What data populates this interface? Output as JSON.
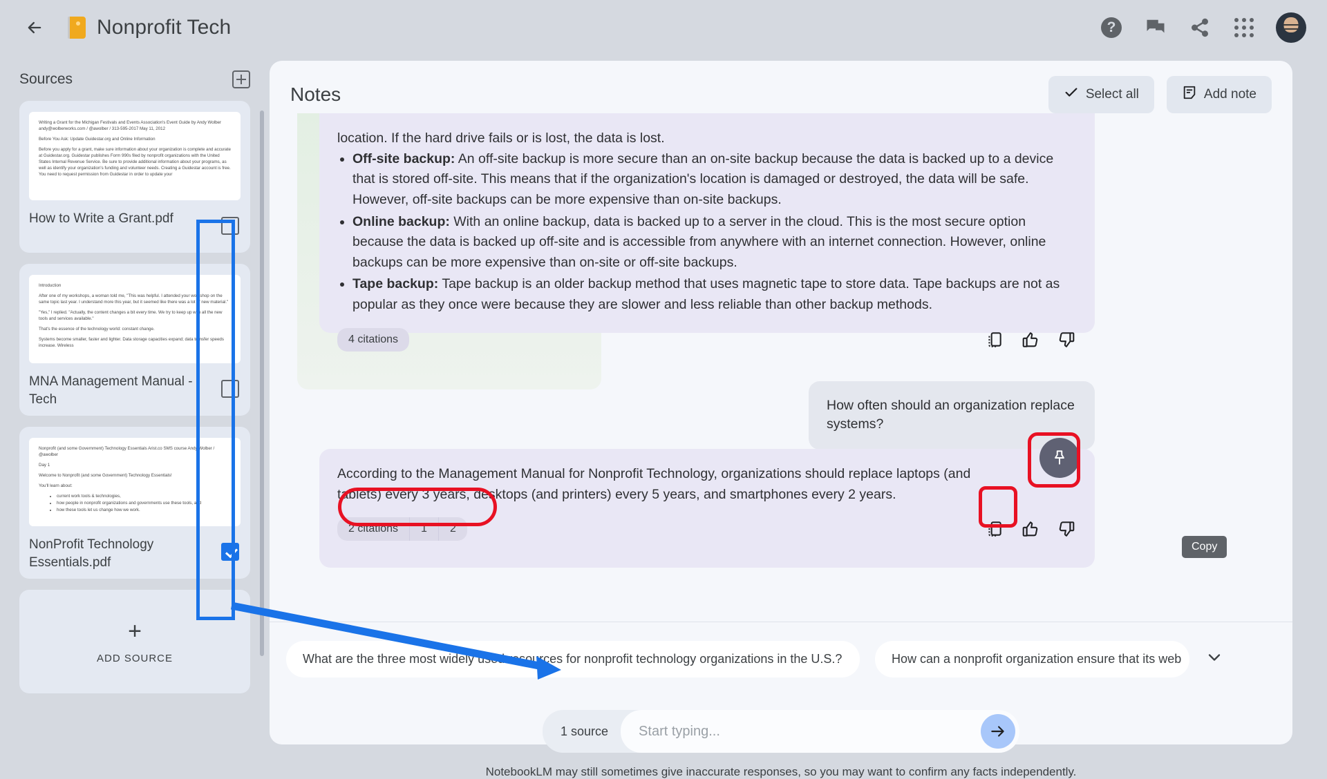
{
  "app": {
    "notebook_title": "Nonprofit Tech",
    "back_icon": "back-arrow-icon",
    "notebook_icon": "notebook-icon",
    "help_label": "?",
    "icons": [
      "help-icon",
      "feedback-icon",
      "share-icon",
      "apps-grid-icon",
      "avatar"
    ]
  },
  "sidebar": {
    "title": "Sources",
    "add_source_icon": "add-box-icon",
    "add_source_label": "ADD SOURCE",
    "sources": [
      {
        "name": "How to Write a Grant.pdf",
        "checked": false,
        "preview": [
          "Writing a Grant for the Michigan Festivals and Events Association's Event Guide by Andy Wolber andy@wolberworks.com / @awolber / 313-595-2017 May 11, 2012",
          "Before You Ask: Update Guidestar.org and Online Information",
          "Before you apply for a grant, make sure information about your organization is complete and accurate at Guidestar.org. Guidestar publishes Form 990s filed by nonprofit organizations with the United States Internal Revenue Service. Be sure to provide additional information about your programs, as well as identify your organization's funding and volunteer needs. Creating a Guidestar account is free. You need to request permission from Guidestar in order to update your"
        ]
      },
      {
        "name": "MNA Management Manual - Tech",
        "checked": false,
        "preview": [
          "Introduction",
          "After one of my workshops, a woman told me, \"This was helpful. I attended your workshop on the same topic last year. I understand more this year, but it seemed like there was a lot of new material.\"",
          "\"Yes,\" I replied. \"Actually, the content changes a bit every time. We try to keep up with all the new tools and services available.\"",
          "That's the essence of the technology world: constant change.",
          "Systems become smaller, faster and lighter. Data storage capacities expand; data transfer speeds increase. Wireless"
        ]
      },
      {
        "name": "NonProfit Technology Essentials.pdf",
        "checked": true,
        "preview": [
          "Nonprofit (and some Government) Technology Essentials Arist.co SMS course Andy Wolber / @awolber",
          "Day 1",
          "Welcome to Nonprofit (and some Government) Technology Essentials!",
          "You'll learn about:"
        ],
        "preview_bullets": [
          "current work tools & technologies,",
          "how people in nonprofit organizations and governments use these tools, and",
          "how these tools let us change how we work."
        ]
      }
    ]
  },
  "main": {
    "panel_title": "Notes",
    "select_all_label": "Select all",
    "select_all_icon": "check-icon",
    "add_note_label": "Add note",
    "add_note_icon": "note-icon",
    "answers": [
      {
        "intro": "location. If the hard drive fails or is lost, the data is lost.",
        "bullets": [
          {
            "term": "Off-site backup:",
            "text": " An off-site backup is more secure than an on-site backup because the data is backed up to a device that is stored off-site. This means that if the organization's location is damaged or destroyed, the data will be safe. However, off-site backups can be more expensive than on-site backups."
          },
          {
            "term": "Online backup:",
            "text": " With an online backup, data is backed up to a server in the cloud. This is the most secure option because the data is backed up off-site and is accessible from anywhere with an internet connection. However, online backups can be more expensive than on-site or off-site backups."
          },
          {
            "term": "Tape backup:",
            "text": " Tape backup is an older backup method that uses magnetic tape to store data. Tape backups are not as popular as they once were because they are slower and less reliable than other backup methods."
          }
        ],
        "citations_label": "4 citations"
      },
      {
        "text": "According to the Management Manual for Nonprofit Technology, organizations should replace laptops (and tablets) every 3 years, desktops (and printers) every 5 years, and smartphones every 2 years.",
        "citations_label": "2 citations",
        "citation_numbers": [
          "1",
          "2"
        ],
        "pin_icon": "pin-icon"
      }
    ],
    "user_question": "How often should an organization replace systems?",
    "copy_tooltip": "Copy",
    "action_icons": [
      "copy-icon",
      "thumb-up-icon",
      "thumb-down-icon"
    ],
    "suggestions": [
      "What are the three most widely used resources for nonprofit technology organizations in the U.S.?",
      "How can a nonprofit organization ensure that its web"
    ],
    "expand_icon": "chevron-down-icon",
    "composer": {
      "source_count": "1 source",
      "placeholder": "Start typing...",
      "value": "",
      "send_icon": "arrow-right-icon"
    },
    "disclaimer": "NotebookLM may still sometimes give inaccurate responses, so you may want to confirm any facts independently."
  },
  "annotations": {
    "blue_color": "#1a73e8",
    "red_color": "#e81123",
    "blue_rect_name": "source-checkbox-column-highlight",
    "red_rects": [
      "citations-highlight",
      "copy-button-highlight",
      "pin-button-highlight"
    ],
    "arrow_name": "blue-arrow-to-source-count"
  }
}
